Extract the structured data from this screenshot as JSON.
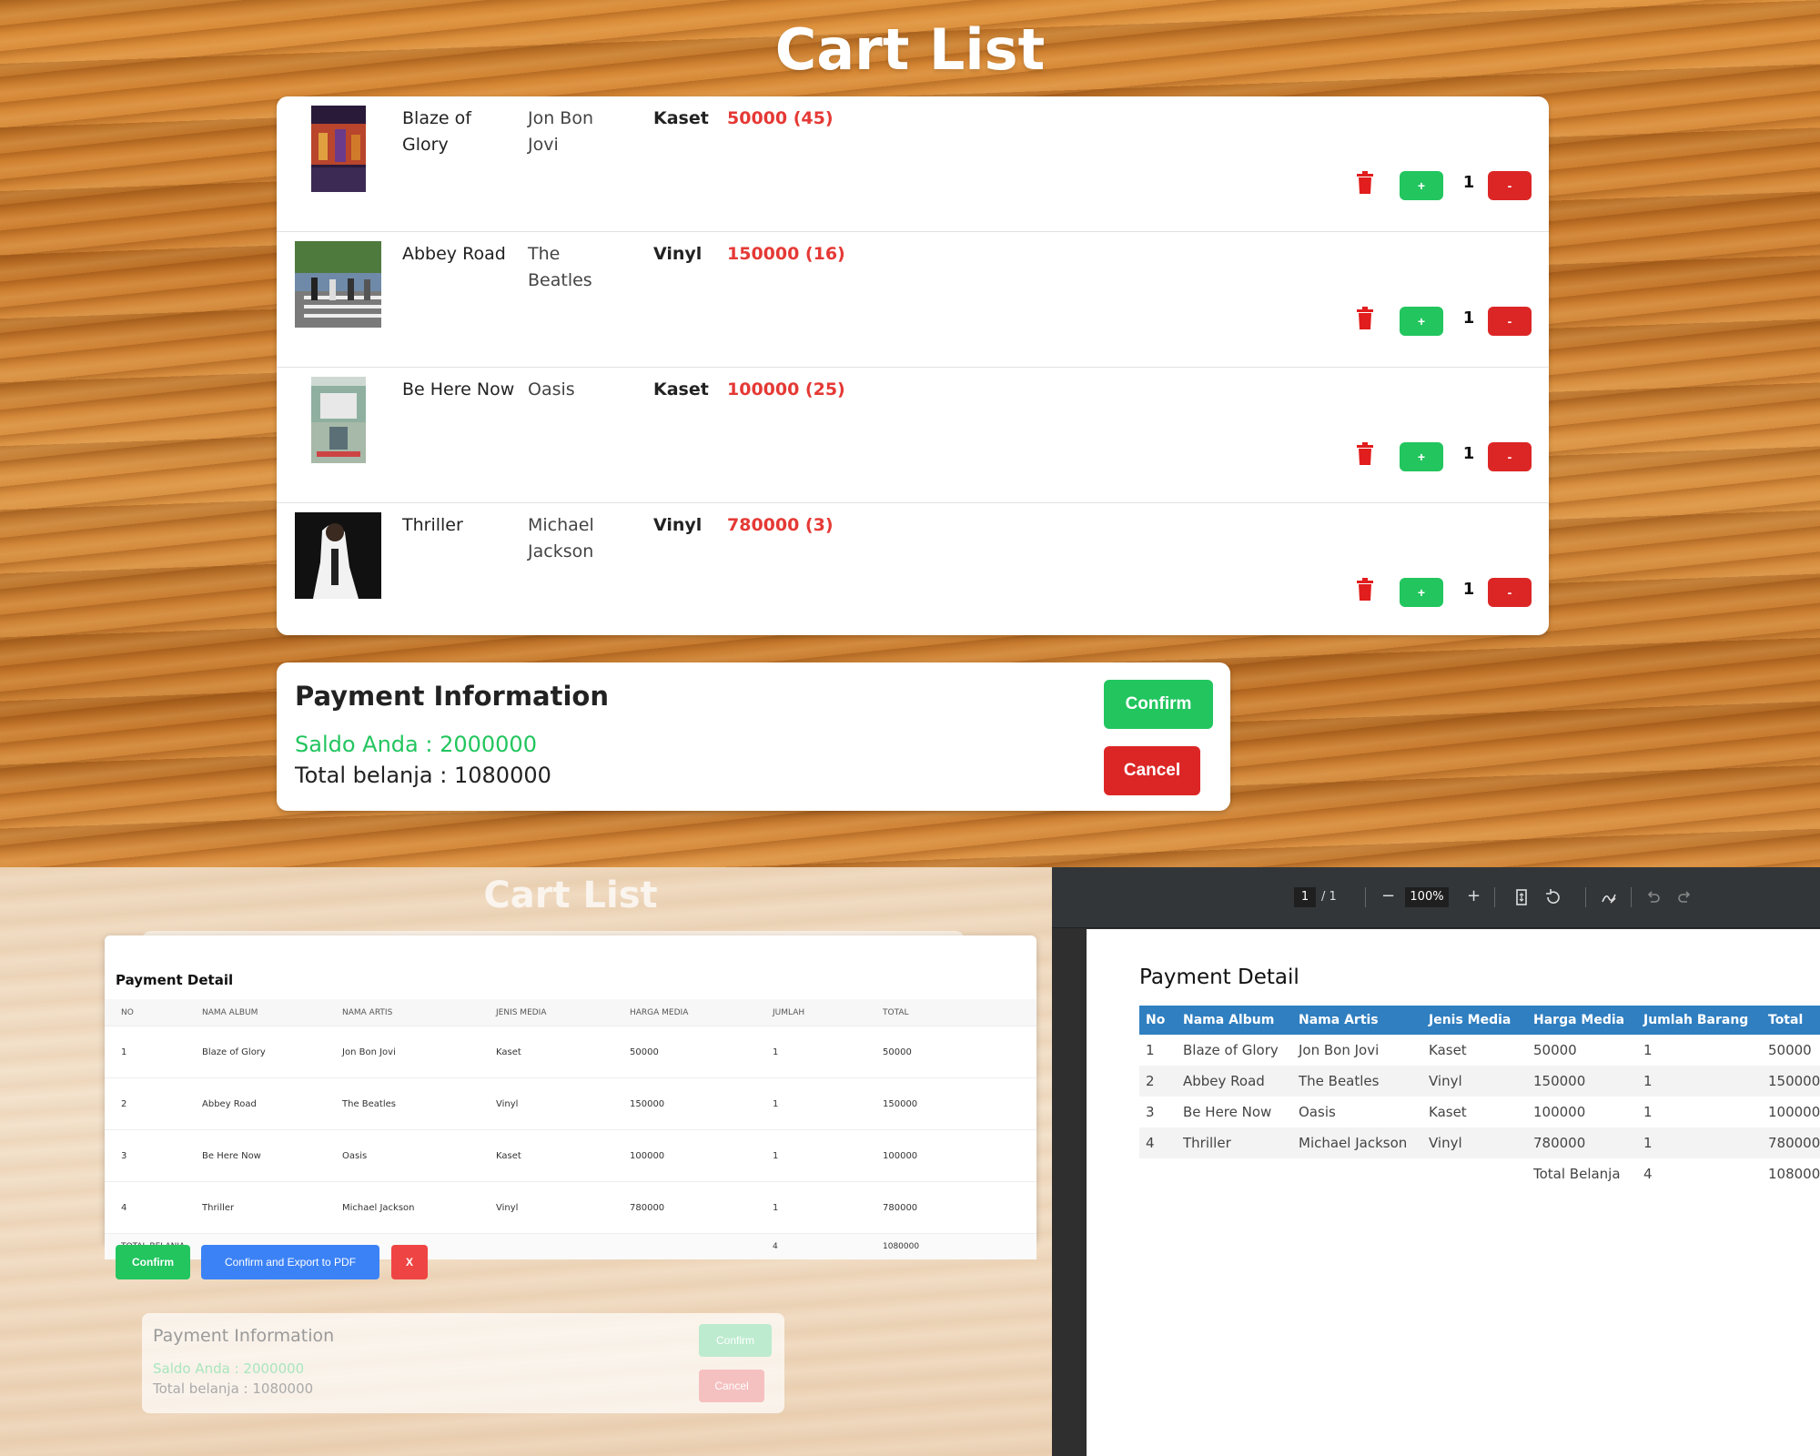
{
  "top": {
    "title": "Cart List",
    "items": [
      {
        "album": "Blaze of Glory",
        "artist": "Jon Bon Jovi",
        "media": "Kaset",
        "price": "50000 (45)",
        "qty": "1"
      },
      {
        "album": "Abbey Road",
        "artist": "The Beatles",
        "media": "Vinyl",
        "price": "150000 (16)",
        "qty": "1"
      },
      {
        "album": "Be Here Now",
        "artist": "Oasis",
        "media": "Kaset",
        "price": "100000 (25)",
        "qty": "1"
      },
      {
        "album": "Thriller",
        "artist": "Michael Jackson",
        "media": "Vinyl",
        "price": "780000 (3)",
        "qty": "1"
      }
    ],
    "plus_label": "+",
    "minus_label": "-",
    "payment": {
      "title": "Payment Information",
      "saldo": "Saldo Anda : 2000000",
      "total": "Total belanja : 1080000",
      "confirm": "Confirm",
      "cancel": "Cancel"
    }
  },
  "modal_view": {
    "title": "Cart List",
    "detail_title": "Payment Detail",
    "headers": [
      "NO",
      "NAMA ALBUM",
      "NAMA ARTIS",
      "JENIS MEDIA",
      "HARGA MEDIA",
      "JUMLAH",
      "TOTAL"
    ],
    "rows": [
      [
        "1",
        "Blaze of Glory",
        "Jon Bon Jovi",
        "Kaset",
        "50000",
        "1",
        "50000"
      ],
      [
        "2",
        "Abbey Road",
        "The Beatles",
        "Vinyl",
        "150000",
        "1",
        "150000"
      ],
      [
        "3",
        "Be Here Now",
        "Oasis",
        "Kaset",
        "100000",
        "1",
        "100000"
      ],
      [
        "4",
        "Thriller",
        "Michael Jackson",
        "Vinyl",
        "780000",
        "1",
        "780000"
      ]
    ],
    "total_label": "TOTAL BELANJA",
    "total_qty": "4",
    "total_value": "1080000",
    "confirm": "Confirm",
    "export": "Confirm and Export to PDF",
    "close": "X",
    "bg_payment": {
      "title": "Payment Information",
      "saldo": "Saldo Anda : 2000000",
      "total": "Total belanja : 1080000",
      "confirm": "Confirm",
      "cancel": "Cancel"
    }
  },
  "pdf_view": {
    "page_current": "1",
    "page_of": "/  1",
    "zoom": "100%",
    "zoom_out": "−",
    "zoom_in": "+",
    "title": "Payment Detail",
    "headers": [
      "No",
      "Nama Album",
      "Nama Artis",
      "Jenis Media",
      "Harga Media",
      "Jumlah Barang",
      "Total"
    ],
    "rows": [
      [
        "1",
        "Blaze of Glory",
        "Jon Bon Jovi",
        "Kaset",
        "50000",
        "1",
        "50000"
      ],
      [
        "2",
        "Abbey Road",
        "The Beatles",
        "Vinyl",
        "150000",
        "1",
        "150000"
      ],
      [
        "3",
        "Be Here Now",
        "Oasis",
        "Kaset",
        "100000",
        "1",
        "100000"
      ],
      [
        "4",
        "Thriller",
        "Michael Jackson",
        "Vinyl",
        "780000",
        "1",
        "780000"
      ]
    ],
    "total_label": "Total Belanja",
    "total_qty": "4",
    "total_value": "108000"
  },
  "colors": {
    "green": "#22c55e",
    "red": "#dc2626",
    "blue": "#3b82f6",
    "pdf_header": "#2f7fc1"
  }
}
